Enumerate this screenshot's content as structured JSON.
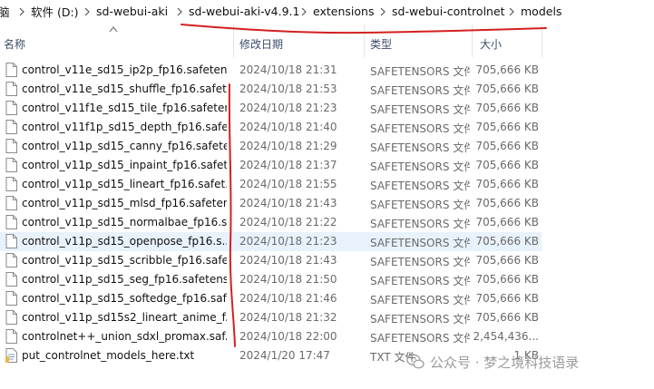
{
  "breadcrumb": [
    {
      "label": "脑"
    },
    {
      "label": "软件 (D:)"
    },
    {
      "label": "sd-webui-aki"
    },
    {
      "label": "sd-webui-aki-v4.9.1"
    },
    {
      "label": "extensions"
    },
    {
      "label": "sd-webui-controlnet"
    },
    {
      "label": "models"
    }
  ],
  "columns": {
    "name": "名称",
    "date": "修改日期",
    "type": "类型",
    "size": "大小"
  },
  "files": [
    {
      "name": "control_v11e_sd15_ip2p_fp16.safeten...",
      "date": "2024/10/18 21:31",
      "type": "SAFETENSORS 文件",
      "size": "705,666 KB",
      "icon": "file-icon"
    },
    {
      "name": "control_v11e_sd15_shuffle_fp16.safet...",
      "date": "2024/10/18 21:53",
      "type": "SAFETENSORS 文件",
      "size": "705,666 KB",
      "icon": "file-icon"
    },
    {
      "name": "control_v11f1e_sd15_tile_fp16.safeten...",
      "date": "2024/10/18 21:23",
      "type": "SAFETENSORS 文件",
      "size": "705,666 KB",
      "icon": "file-icon"
    },
    {
      "name": "control_v11f1p_sd15_depth_fp16.safe...",
      "date": "2024/10/18 21:40",
      "type": "SAFETENSORS 文件",
      "size": "705,666 KB",
      "icon": "file-icon"
    },
    {
      "name": "control_v11p_sd15_canny_fp16.safete...",
      "date": "2024/10/18 21:29",
      "type": "SAFETENSORS 文件",
      "size": "705,666 KB",
      "icon": "file-icon"
    },
    {
      "name": "control_v11p_sd15_inpaint_fp16.safet...",
      "date": "2024/10/18 21:37",
      "type": "SAFETENSORS 文件",
      "size": "705,666 KB",
      "icon": "file-icon"
    },
    {
      "name": "control_v11p_sd15_lineart_fp16.safet...",
      "date": "2024/10/18 21:55",
      "type": "SAFETENSORS 文件",
      "size": "705,666 KB",
      "icon": "file-icon"
    },
    {
      "name": "control_v11p_sd15_mlsd_fp16.safeten...",
      "date": "2024/10/18 21:43",
      "type": "SAFETENSORS 文件",
      "size": "705,666 KB",
      "icon": "file-icon"
    },
    {
      "name": "control_v11p_sd15_normalbae_fp16.s...",
      "date": "2024/10/18 21:22",
      "type": "SAFETENSORS 文件",
      "size": "705,666 KB",
      "icon": "file-icon"
    },
    {
      "name": "control_v11p_sd15_openpose_fp16.s...",
      "date": "2024/10/18 21:23",
      "type": "SAFETENSORS 文件",
      "size": "705,666 KB",
      "icon": "file-icon",
      "highlighted": true
    },
    {
      "name": "control_v11p_sd15_scribble_fp16.safe...",
      "date": "2024/10/18 21:43",
      "type": "SAFETENSORS 文件",
      "size": "705,666 KB",
      "icon": "file-icon"
    },
    {
      "name": "control_v11p_sd15_seg_fp16.safetens...",
      "date": "2024/10/18 21:50",
      "type": "SAFETENSORS 文件",
      "size": "705,666 KB",
      "icon": "file-icon"
    },
    {
      "name": "control_v11p_sd15_softedge_fp16.saf...",
      "date": "2024/10/18 21:46",
      "type": "SAFETENSORS 文件",
      "size": "705,666 KB",
      "icon": "file-icon"
    },
    {
      "name": "control_v11p_sd15s2_lineart_anime_f...",
      "date": "2024/10/18 21:32",
      "type": "SAFETENSORS 文件",
      "size": "705,666 KB",
      "icon": "file-icon"
    },
    {
      "name": "controlnet++_union_sdxl_promax.saf...",
      "date": "2024/10/18 22:00",
      "type": "SAFETENSORS 文件",
      "size": "2,454,436...",
      "icon": "file-icon"
    },
    {
      "name": "put_controlnet_models_here.txt",
      "date": "2024/1/20 17:47",
      "type": "TXT 文件",
      "size": "1 KB",
      "icon": "text-file-icon"
    }
  ],
  "watermark": "公众号 · 梦之境科技语录",
  "colors": {
    "annotation": "#d42020",
    "highlight": "#e8f2fc",
    "muted_text": "#6a6a6a"
  }
}
